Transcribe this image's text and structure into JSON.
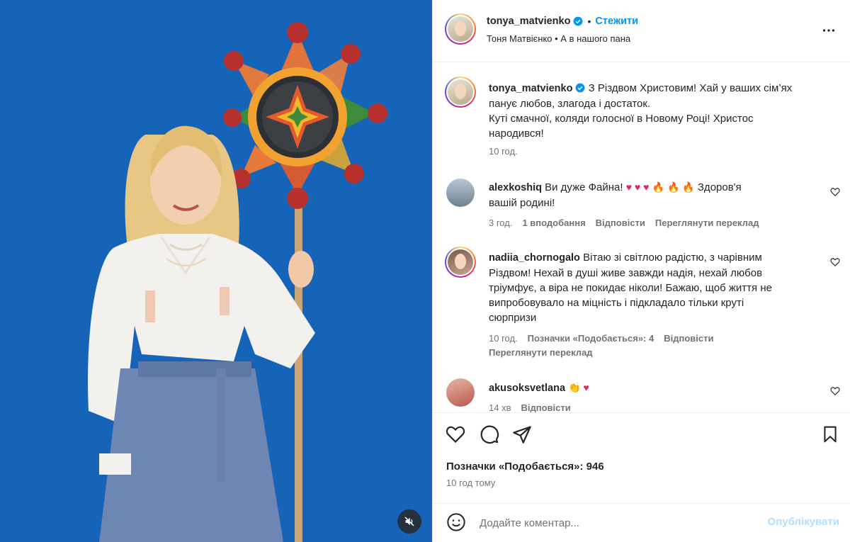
{
  "colors": {
    "media_background": "#1664b8",
    "accent": "#0095f6",
    "verified": "#0095f6",
    "publish_disabled": "#b2dffc"
  },
  "header": {
    "username": "tonya_matvienko",
    "separator": "•",
    "follow_label": "Стежити",
    "subtitle": "Тоня Матвієнко • А в нашого пана"
  },
  "caption": {
    "username": "tonya_matvienko",
    "text_line1": "З Різдвом Христовим! Хай у ваших сім’ях",
    "text_line2": "панує любов, злагода і достаток.",
    "text_line3": "Куті смачної, коляди голосної в Новому Році! Христос",
    "text_line4": "народився!",
    "time": "10 год."
  },
  "comments": [
    {
      "username": "alexkoshiq",
      "text_a": "Ви дуже Файна!",
      "emoji_hearts": "♥ ♥ ♥",
      "emoji_fires": "🔥 🔥 🔥",
      "text_b": "Здоров'я",
      "text_c": "вашій родині!",
      "time": "3 год.",
      "likes": "1 вподобання",
      "reply": "Відповісти",
      "translate": "Переглянути переклад"
    },
    {
      "username": "nadiia_chornogalo",
      "text_line1": "Вітаю зі світлою радістю, з чарівним",
      "text_line2": "Різдвом! Нехай в душі живе завжди надія, нехай любов",
      "text_line3": "тріумфує, а віра не покидає ніколи! Бажаю, щоб життя не",
      "text_line4": "випробовувало на міцність і підкладало тільки круті",
      "text_line5": "сюрпризи",
      "time": "10 год.",
      "likes": "Позначки «Подобається»: 4",
      "reply": "Відповісти",
      "translate": "Переглянути переклад"
    },
    {
      "username": "akusoksvetlana",
      "emoji": "👏 ♥",
      "time": "14 хв",
      "reply": "Відповісти"
    }
  ],
  "actions": {
    "likes_text": "Позначки «Подобається»: 946",
    "post_time": "10 год тому"
  },
  "add_comment": {
    "placeholder": "Додайте коментар...",
    "publish_label": "Опублікувати"
  },
  "icons": {
    "more": "more-horizontal-icon",
    "like": "heart-outline-icon",
    "comment": "comment-bubble-icon",
    "share": "paper-plane-icon",
    "save": "bookmark-icon",
    "emoji": "smile-icon",
    "mute": "speaker-muted-icon",
    "verified": "verified-badge-icon"
  }
}
